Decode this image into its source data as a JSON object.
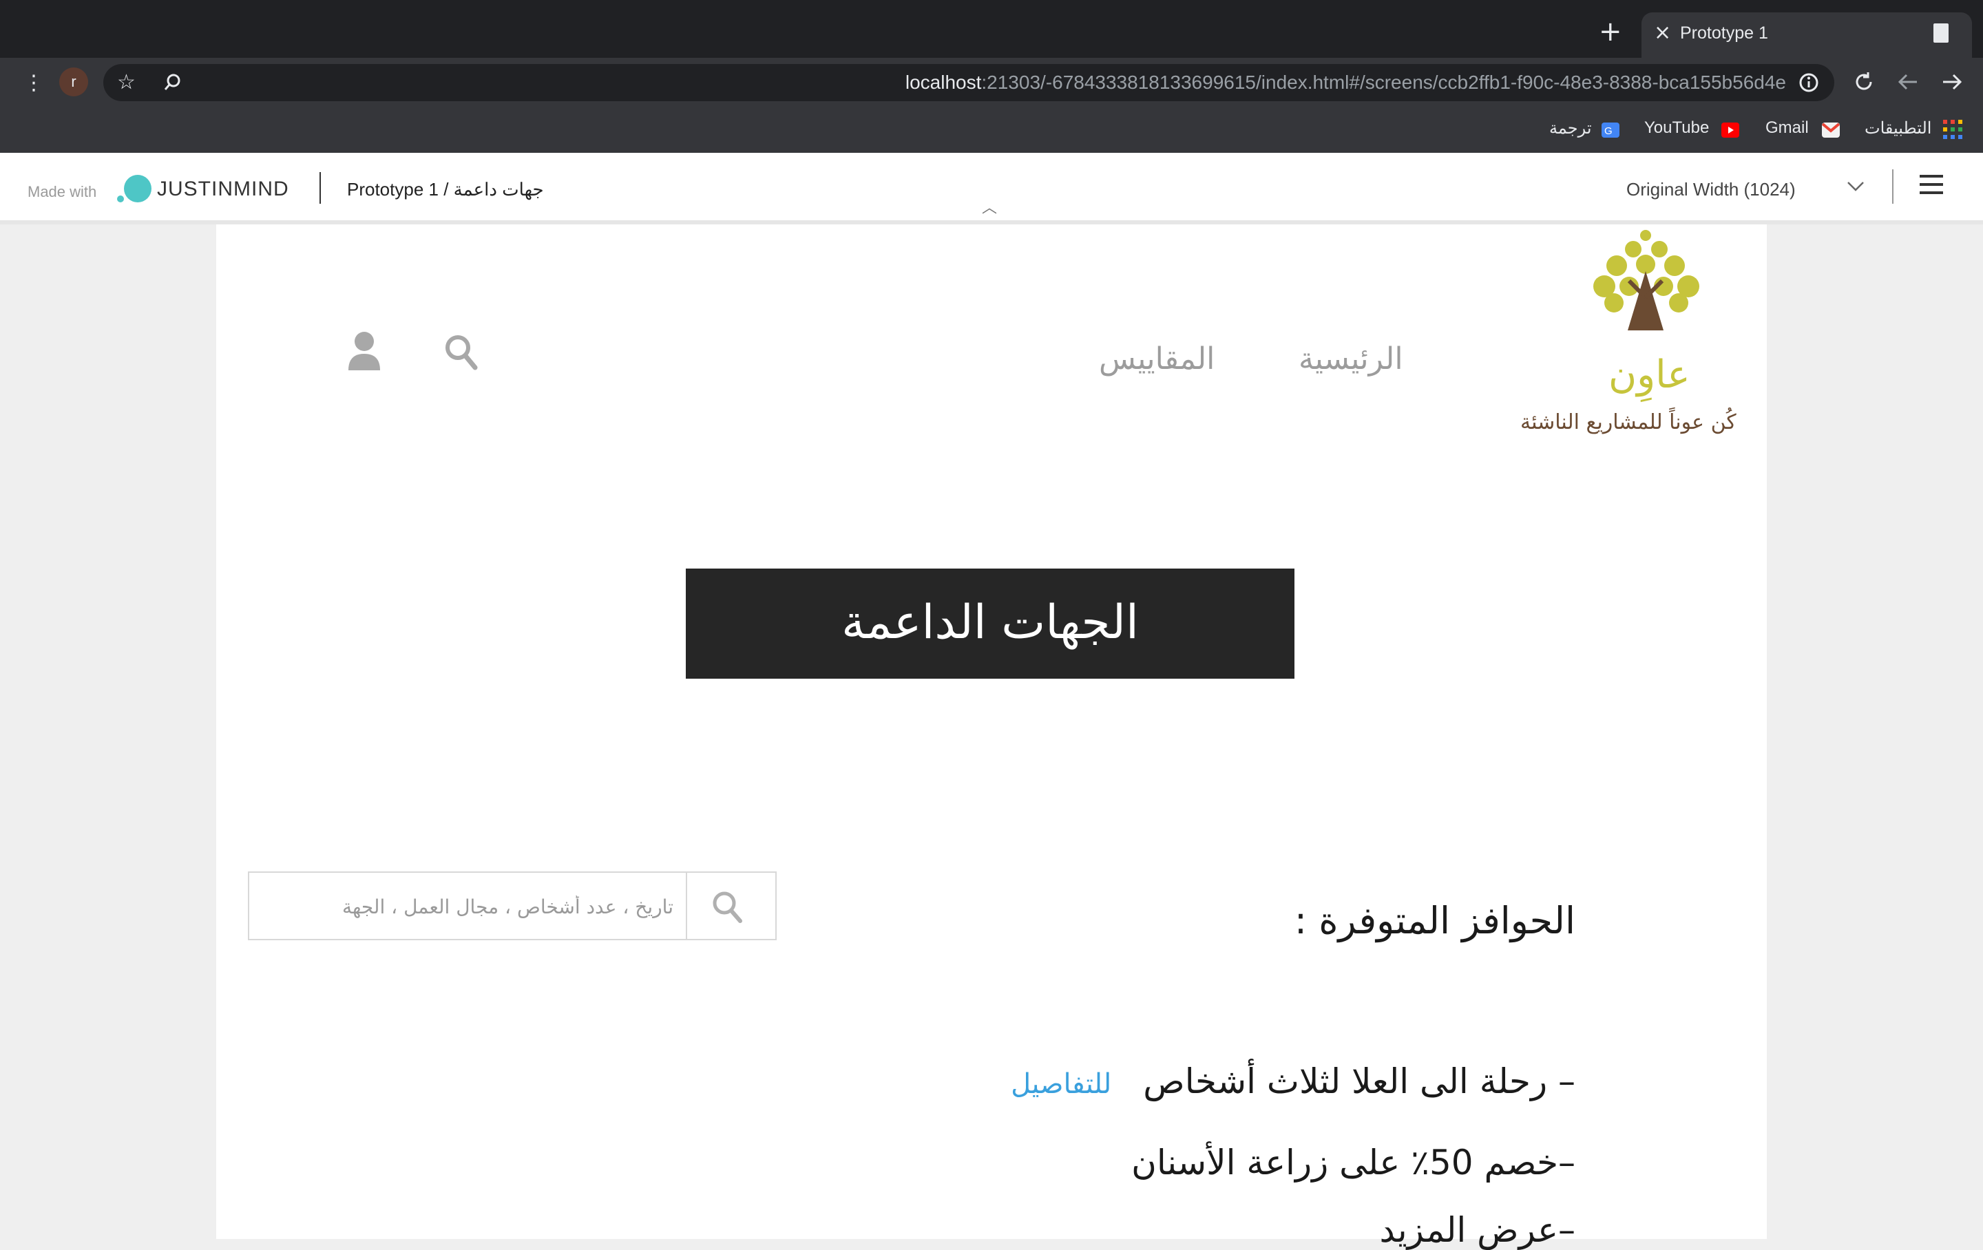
{
  "browser": {
    "tab_title": "Prototype 1",
    "url_host": "localhost",
    "url_rest": ":21303/-6784333818133699615/index.html#/screens/ccb2ffb1-f90c-48e3-8388-bca155b56d4e",
    "avatar_letter": "r",
    "bookmarks": [
      {
        "label": "التطبيقات",
        "icon": "apps-grid-icon"
      },
      {
        "label": "Gmail",
        "icon": "gmail-icon"
      },
      {
        "label": "YouTube",
        "icon": "youtube-icon"
      },
      {
        "label": "ترجمة",
        "icon": "translate-icon"
      }
    ]
  },
  "justinmind": {
    "made_with": "Made with",
    "logo": "JUSTINMIND",
    "breadcrumb": "Prototype 1  /  جهات داعمة",
    "width_select": "Original Width (1024)"
  },
  "site": {
    "brand_name": "عاوِن",
    "tagline": "كُن عوناً للمشاريع الناشئة",
    "nav": [
      "الرئيسية",
      "المقاييس"
    ],
    "hero_title": "الجهات الداعمة",
    "search_placeholder": "تاريخ ، عدد أشخاص ، مجال العمل ، الجهة",
    "section_title": "الحوافز المتوفرة :",
    "incentives": [
      {
        "text": "–  رحلة الى العلا لثلاث أشخاص",
        "link": "للتفاصيل"
      },
      {
        "text": "–خصم 50٪ على زراعة الأسنان"
      },
      {
        "text": "–عرض المزيد"
      }
    ]
  },
  "colors": {
    "brand_green": "#c6c43c",
    "brand_brown": "#6b4b32",
    "hero_bg": "#262626",
    "link": "#3aa0dd"
  }
}
